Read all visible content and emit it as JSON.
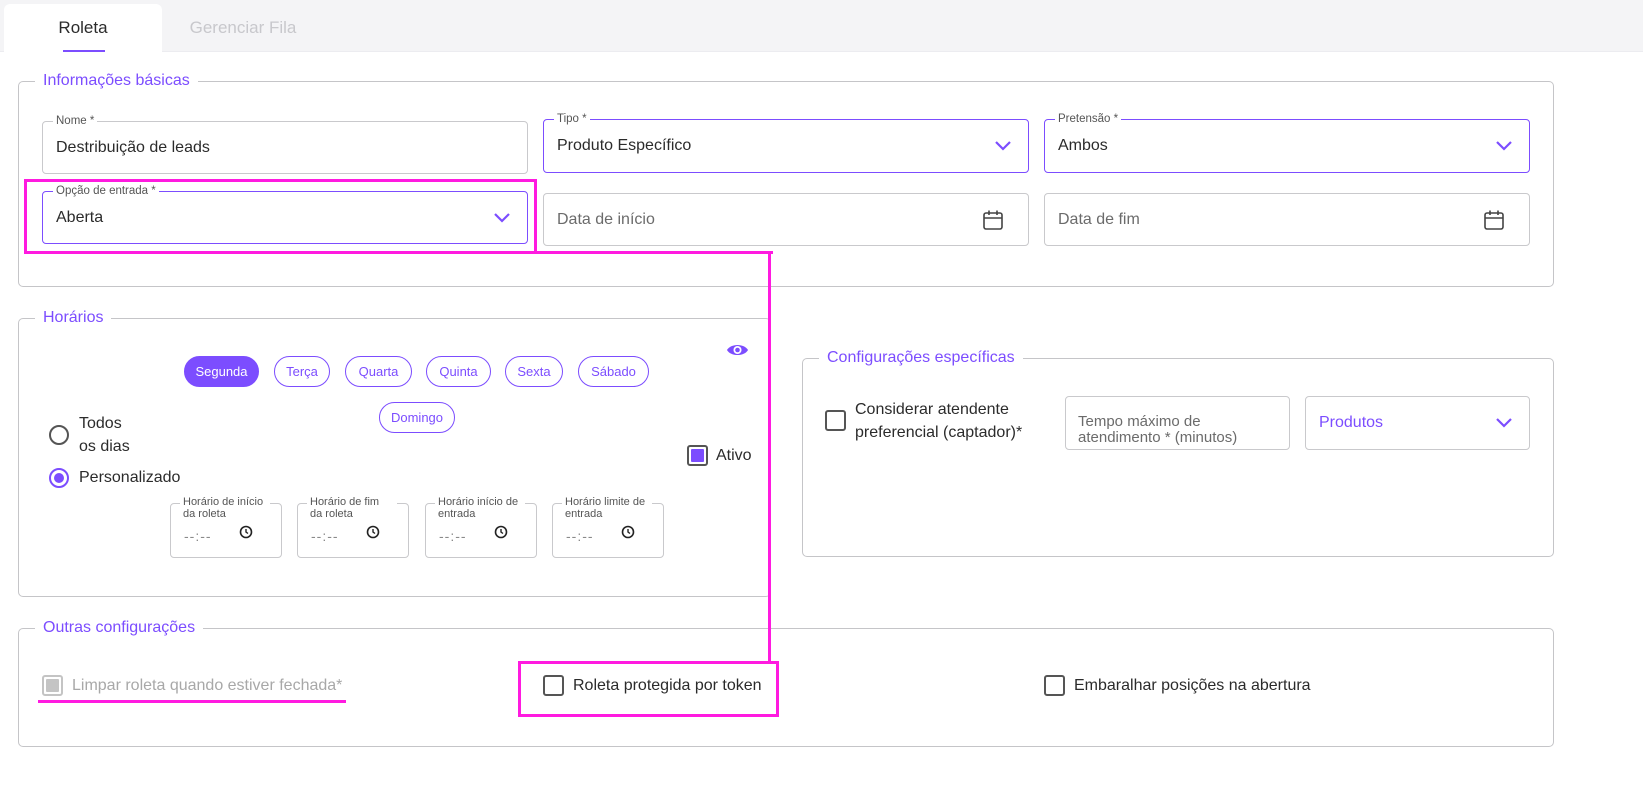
{
  "tabs": [
    {
      "label": "Roleta",
      "active": true
    },
    {
      "label": "Gerenciar Fila",
      "active": false
    }
  ],
  "basic": {
    "legend": "Informações básicas",
    "nome": {
      "label": "Nome *",
      "value": "Destribuição de leads"
    },
    "tipo": {
      "label": "Tipo *",
      "value": "Produto Específico"
    },
    "pretensao": {
      "label": "Pretensão *",
      "value": "Ambos"
    },
    "opcao_entrada": {
      "label": "Opção de entrada *",
      "value": "Aberta"
    },
    "data_inicio": {
      "placeholder": "Data de início"
    },
    "data_fim": {
      "placeholder": "Data de fim"
    }
  },
  "horarios": {
    "legend": "Horários",
    "days": [
      "Segunda",
      "Terça",
      "Quarta",
      "Quinta",
      "Sexta",
      "Sábado",
      "Domingo"
    ],
    "selected_day": "Segunda",
    "radio_todos_line1": "Todos",
    "radio_todos_line2": "os dias",
    "radio_personalizado": "Personalizado",
    "ativo_label": "Ativo",
    "time_fields": [
      {
        "label": "Horário de início da roleta",
        "value": "--:--"
      },
      {
        "label": "Horário de fim da roleta",
        "value": "--:--"
      },
      {
        "label": "Horário início de entrada",
        "value": "--:--"
      },
      {
        "label": "Horário limite de entrada",
        "value": "--:--"
      }
    ]
  },
  "especificas": {
    "legend": "Configurações específicas",
    "considerar_line1": "Considerar atendente",
    "considerar_line2": "preferencial (captador)*",
    "tempo_line1": "Tempo máximo de",
    "tempo_line2": "atendimento * (minutos)",
    "produtos": "Produtos"
  },
  "outras": {
    "legend": "Outras configurações",
    "limpar": "Limpar roleta quando estiver fechada*",
    "token": "Roleta protegida por token",
    "embaralhar": "Embaralhar posições na abertura"
  },
  "colors": {
    "accent": "#7c4dff",
    "highlight": "#ff1ae0",
    "border": "#c5c5c8"
  }
}
